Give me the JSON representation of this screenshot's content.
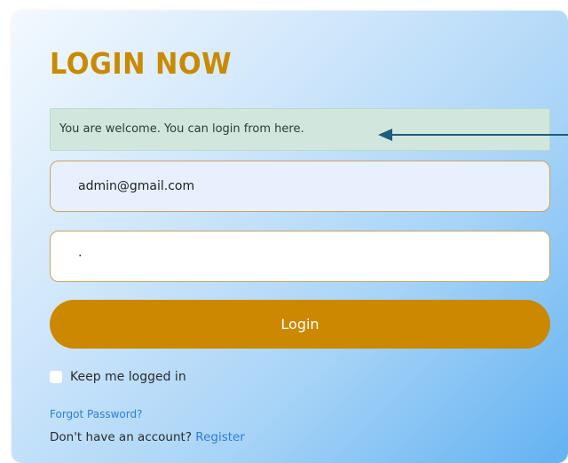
{
  "heading": "LOGIN NOW",
  "alert": {
    "message": "You are welcome. You can login from here."
  },
  "form": {
    "email_value": "admin@gmail.com",
    "password_value": "·",
    "login_label": "Login",
    "remember_label": "Keep me logged in",
    "remember_checked": false
  },
  "links": {
    "forgot_password": "Forgot Password?",
    "no_account_text": "Don't have an account?",
    "register": "Register"
  },
  "colors": {
    "accent": "#cc8800",
    "link": "#2b7fd6",
    "alert_bg": "#d1e7dd",
    "arrow": "#1d5d80"
  }
}
